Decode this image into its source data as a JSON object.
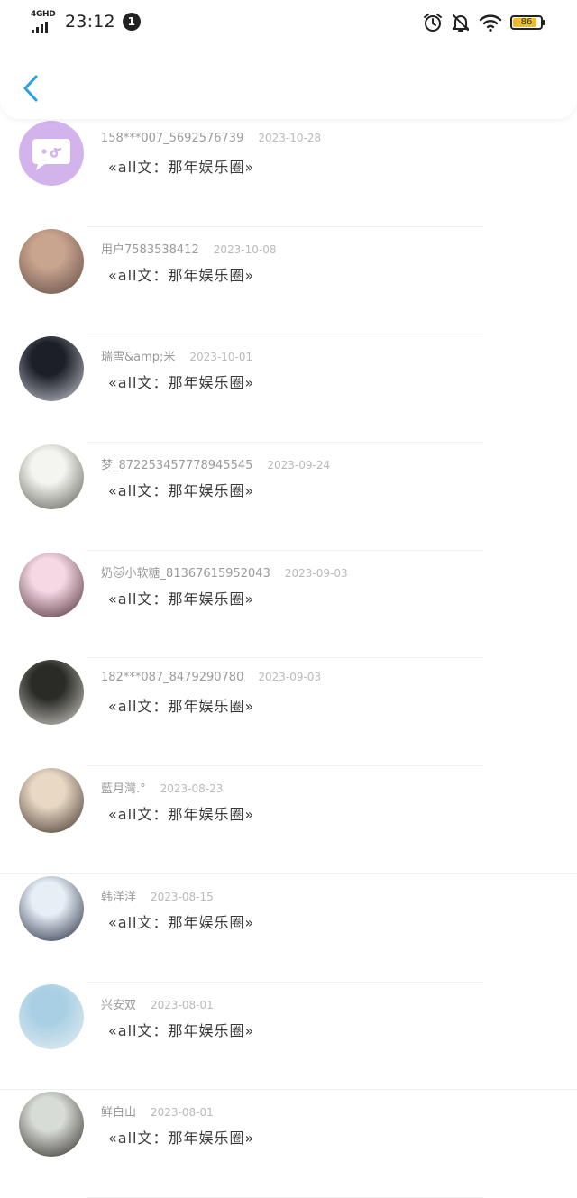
{
  "status_bar": {
    "network": "4GHD",
    "time": "23:12",
    "notification_count": "1",
    "battery_level": "86",
    "battery_fraction": 0.86,
    "icons": [
      "alarm-icon",
      "mute-bell-icon",
      "wifi-icon",
      "battery-icon"
    ]
  },
  "header": {
    "back_icon": "chevron-left-icon",
    "accent_color": "#2a9ee8"
  },
  "readers": [
    {
      "name": "158***007_5692576739",
      "date": "2023-10-28",
      "title": "«all文：那年娱乐圈»",
      "avatar": "message-bubble-icon"
    },
    {
      "name": "用户7583538412",
      "date": "2023-10-08",
      "title": "«all文：那年娱乐圈»",
      "avatar": "photo"
    },
    {
      "name": "瑞雪&amp;米",
      "date": "2023-10-01",
      "title": "«all文：那年娱乐圈»",
      "avatar": "photo"
    },
    {
      "name": "梦_872253457778945545",
      "date": "2023-09-24",
      "title": "«all文：那年娱乐圈»",
      "avatar": "photo"
    },
    {
      "name": "奶🐱小软糖_81367615952043",
      "date": "2023-09-03",
      "title": "«all文：那年娱乐圈»",
      "avatar": "photo"
    },
    {
      "name": "182***087_8479290780",
      "date": "2023-09-03",
      "title": "«all文：那年娱乐圈»",
      "avatar": "photo"
    },
    {
      "name": "藍月灣.°",
      "date": "2023-08-23",
      "title": "«all文：那年娱乐圈»",
      "avatar": "photo"
    },
    {
      "name": "韩洋洋",
      "date": "2023-08-15",
      "title": "«all文：那年娱乐圈»",
      "avatar": "photo"
    },
    {
      "name": "兴安双",
      "date": "2023-08-01",
      "title": "«all文：那年娱乐圈»",
      "avatar": "photo"
    },
    {
      "name": "鲜白山",
      "date": "2023-08-01",
      "title": "«all文：那年娱乐圈»",
      "avatar": "photo"
    }
  ]
}
